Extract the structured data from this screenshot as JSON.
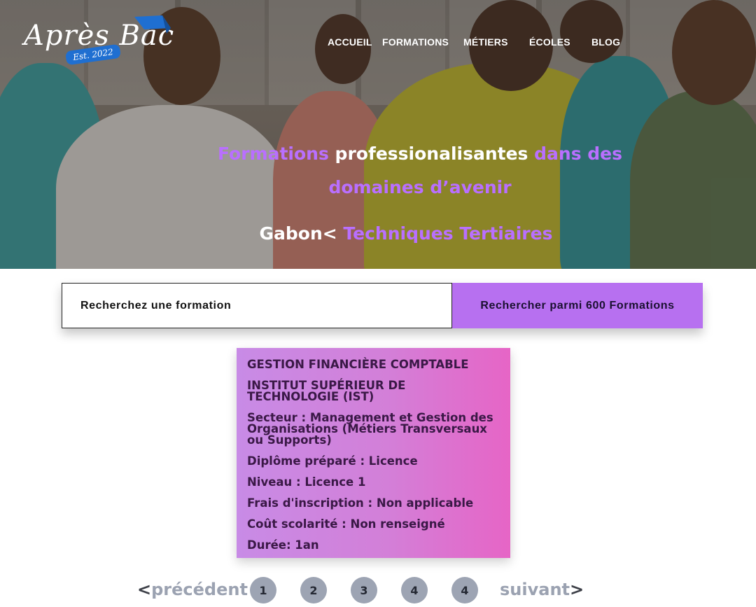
{
  "header": {
    "logo": {
      "name": "Après Bac",
      "badge": "Est. 2022"
    },
    "nav": [
      "ACCUEIL",
      "FORMATIONS",
      "MÉTIERS",
      "ÉCOLES",
      "BLOG"
    ]
  },
  "hero": {
    "title_parts": [
      "Formations",
      " professionalisantes",
      " dans des",
      "domaines d’avenir"
    ],
    "subtitle_parts": [
      "Gabon<",
      " Techniques Tertiaires"
    ]
  },
  "search": {
    "placeholder": "Recherchez une formation",
    "button_label": "Rechercher parmi 600 Formations"
  },
  "card": {
    "title": "GESTION FINANCIÈRE COMPTABLE",
    "school": "INSTITUT SUPÉRIEUR DE TECHNOLOGIE (IST)",
    "secteur": "Secteur : Management et Gestion des Organisations (Métiers Transversaux ou Supports)",
    "diplome": "Diplôme préparé : Licence",
    "niveau": "Niveau : Licence 1",
    "frais": "Frais d'inscription : Non applicable",
    "cout": "Coût scolarité : Non renseigné",
    "duree": "Durée: 1an"
  },
  "pagination": {
    "prev_arrow": "<",
    "prev_label": "précédent",
    "pages": [
      "1",
      "2",
      "3",
      "4",
      "4"
    ],
    "next_label": "suivant",
    "next_arrow": ">"
  },
  "colors": {
    "accent_purple": "#b770f0",
    "card_gradient_start": "#c88be6",
    "card_gradient_end": "#e665c6",
    "pager_grey": "#9da4b3"
  }
}
